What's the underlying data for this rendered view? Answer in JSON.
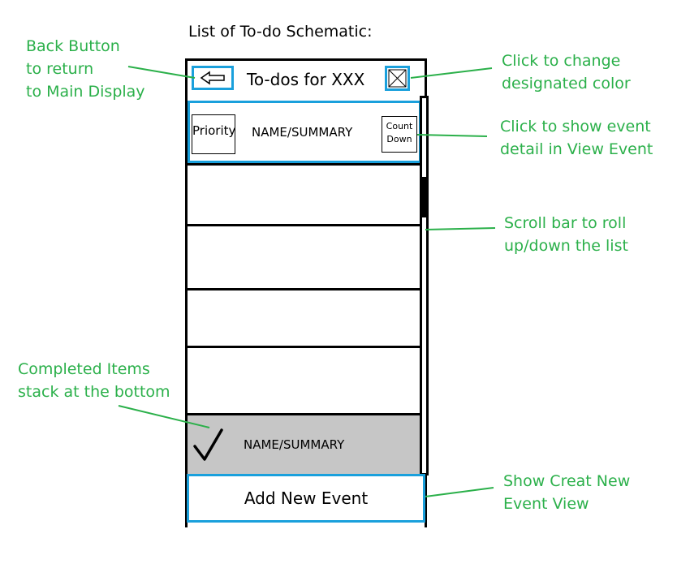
{
  "schematic_title": "List of To-do Schematic:",
  "annotations": {
    "back_button": "Back Button\nto return\nto Main Display",
    "change_color": "Click to change\ndesignated color",
    "show_event": "Click to show event\ndetail in View Event",
    "scroll_bar": "Scroll bar to roll\nup/down the list",
    "completed_items": "Completed Items\nstack at the bottom",
    "create_event": "Show Creat New\nEvent View"
  },
  "header": {
    "title": "To-dos for XXX",
    "back_icon": "left-arrow-icon",
    "color_icon": "crossed-box-icon"
  },
  "event_row": {
    "priority": "Priority",
    "summary": "NAME/SUMMARY",
    "countdown_line1": "Count",
    "countdown_line2": "Down"
  },
  "completed_row": {
    "check_icon": "checkmark-icon",
    "summary": "NAME/SUMMARY"
  },
  "add_button": {
    "label": "Add New Event"
  },
  "colors": {
    "annotation": "#2bb04a",
    "highlight": "#1aa0dc",
    "completed_bg": "#c6c6c6"
  }
}
